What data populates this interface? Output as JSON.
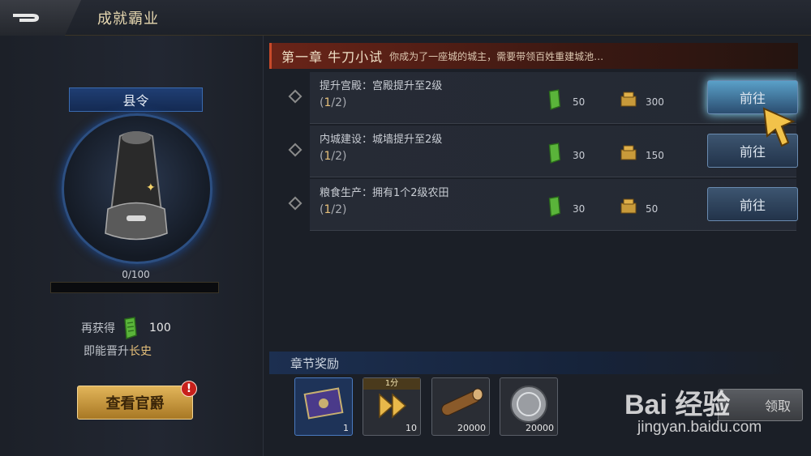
{
  "header": {
    "title": "成就霸业"
  },
  "left": {
    "rank": "县令",
    "progress": "0/100",
    "progress_value": 0,
    "earn_label": "再获得",
    "earn_amount": "100",
    "promote_prefix": "即能晋升",
    "promote_rank": "长史",
    "view_button": "查看官爵",
    "alert": "!"
  },
  "chapter": {
    "title": "第一章 牛刀小试",
    "desc": "你成为了一座城的城主，需要带领百姓重建城池…"
  },
  "tasks": [
    {
      "name": "提升宫殿：宫殿提升至2级",
      "prog_open": "(",
      "prog_cur": "1",
      "prog_rest": "/2)",
      "reward1": "50",
      "reward2": "300",
      "button": "前往"
    },
    {
      "name": "内城建设：城墙提升至2级",
      "prog_open": "(",
      "prog_cur": "1",
      "prog_rest": "/2)",
      "reward1": "30",
      "reward2": "150",
      "button": "前往"
    },
    {
      "name": "粮食生产：拥有1个2级农田",
      "prog_open": "(",
      "prog_cur": "1",
      "prog_rest": "/2)",
      "reward1": "30",
      "reward2": "50",
      "button": "前往"
    }
  ],
  "chapter_reward": {
    "label": "章节奖励",
    "items": [
      {
        "icon": "scroll-icon",
        "count": "1"
      },
      {
        "icon": "speedup-icon",
        "tag": "1分",
        "count": "10"
      },
      {
        "icon": "wood-icon",
        "count": "20000"
      },
      {
        "icon": "silver-coin-icon",
        "count": "20000"
      }
    ],
    "claim_button": "领取"
  },
  "watermark": {
    "text": "Bai 经验",
    "url": "jingyan.baidu.com"
  }
}
